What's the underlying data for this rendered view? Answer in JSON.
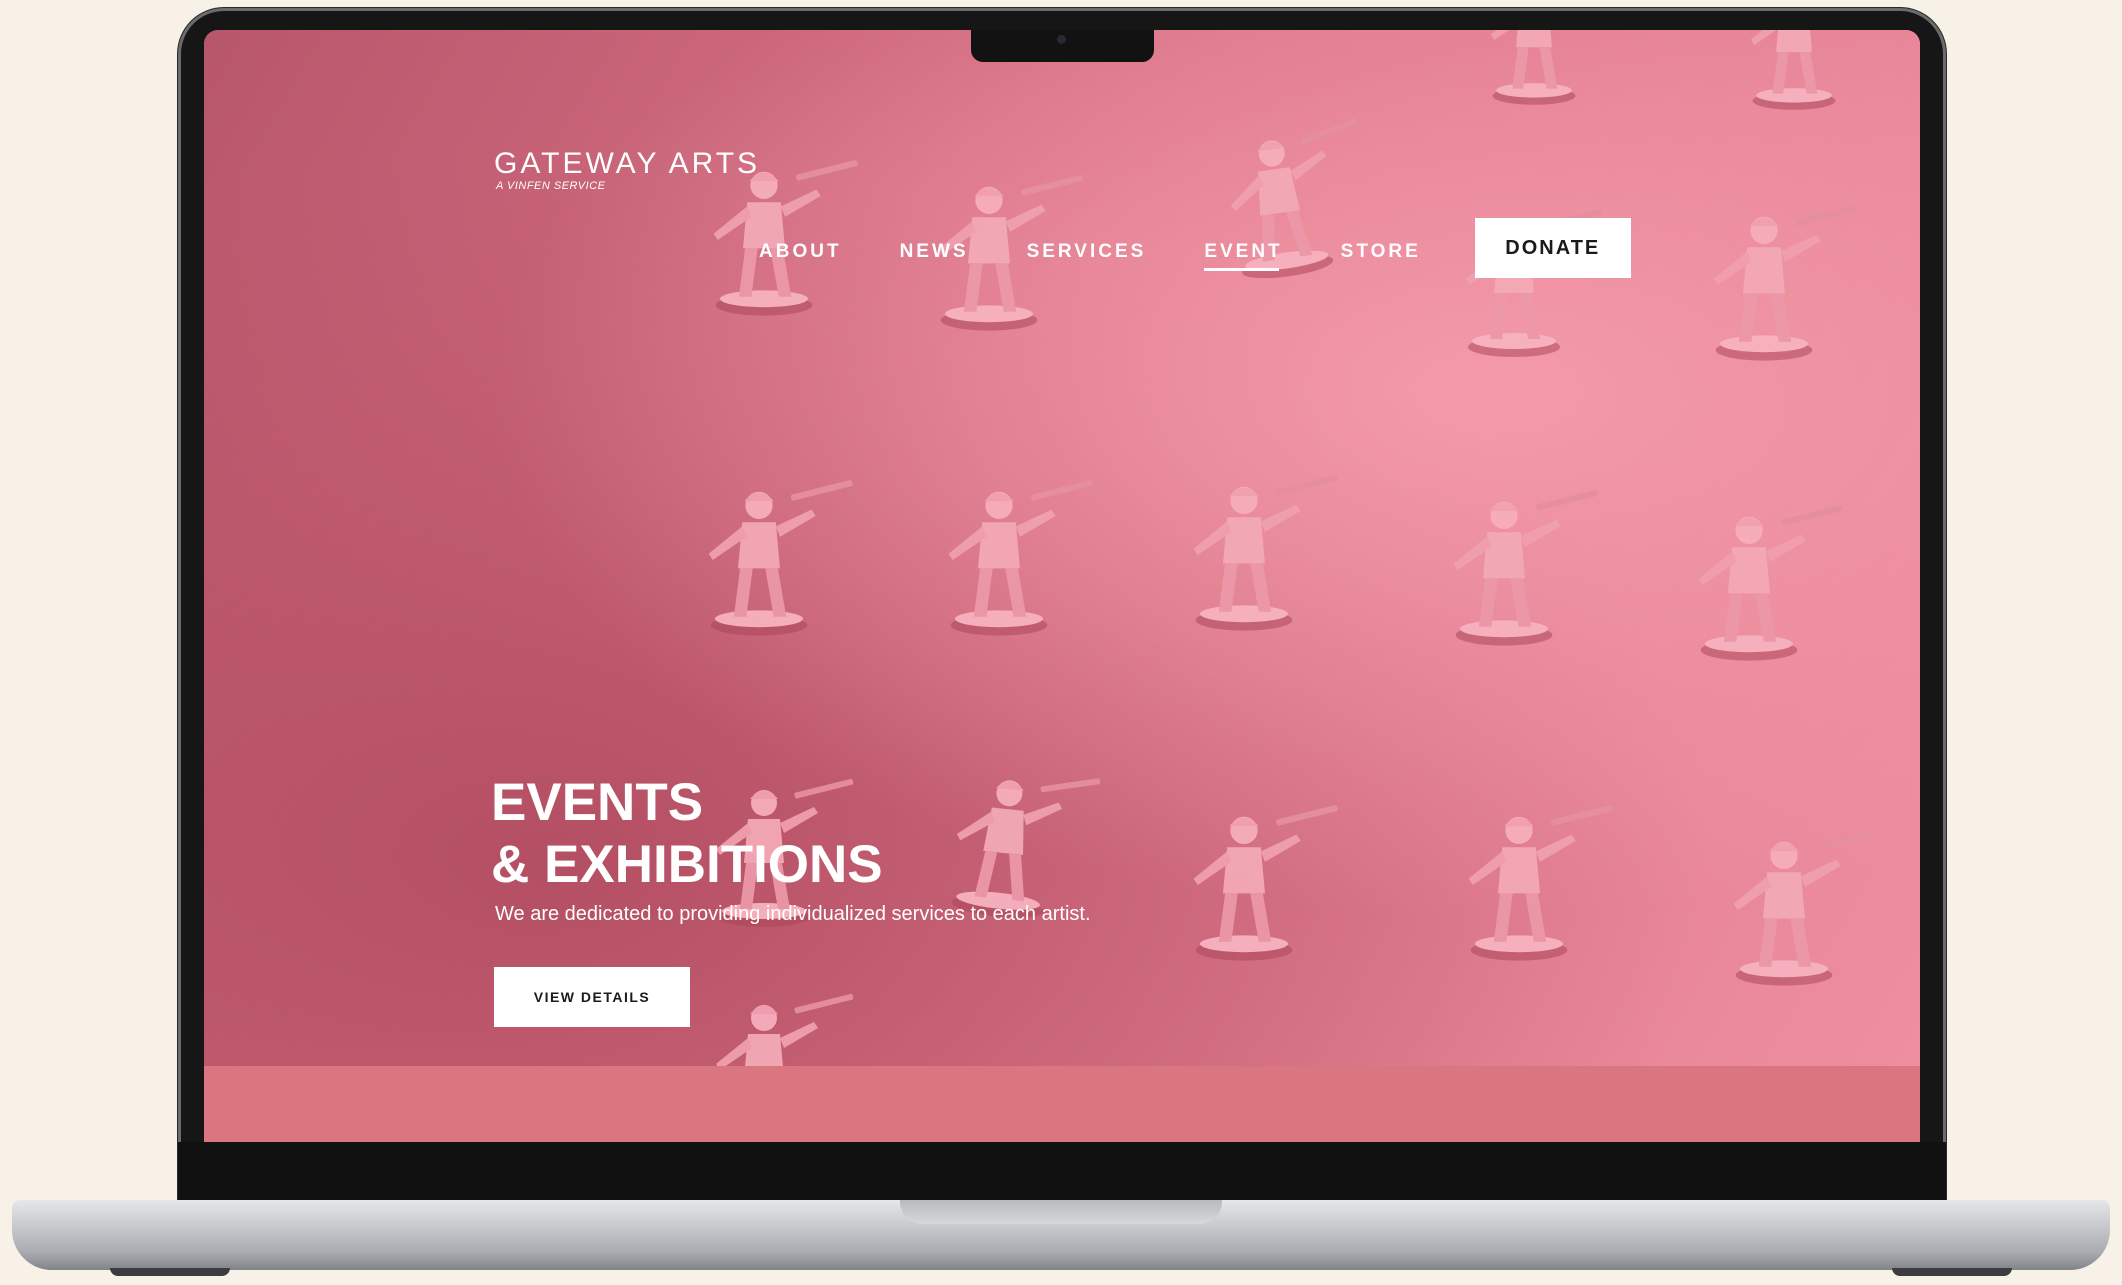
{
  "brand": {
    "name": "GATEWAY ARTS",
    "tagline": "A VINFEN SERVICE"
  },
  "nav": {
    "items": [
      {
        "label": "ABOUT",
        "active": false
      },
      {
        "label": "NEWS",
        "active": false
      },
      {
        "label": "SERVICES",
        "active": false
      },
      {
        "label": "EVENT",
        "active": true
      },
      {
        "label": "STORE",
        "active": false
      }
    ],
    "donate_label": "DONATE"
  },
  "hero": {
    "title_line1": "EVENTS",
    "title_line2": "& EXHIBITIONS",
    "subtitle": "We are dedicated to providing individualized services to each artist.",
    "cta_label": "VIEW DETAILS"
  },
  "colors": {
    "page_background": "#f8f1e7",
    "hero_pink": "#dc7488",
    "footer_band": "#d9767f",
    "text_on_hero": "#ffffff",
    "button_background": "#ffffff",
    "button_text": "#1b1b1b"
  }
}
